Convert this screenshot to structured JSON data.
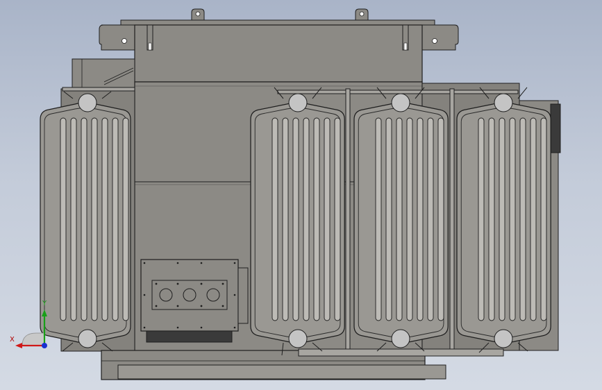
{
  "viewport": {
    "background_top": "#a9b4c8",
    "background_bottom": "#d4dae4"
  },
  "model": {
    "body_color": "#8c8a85",
    "edge_color": "#1e1e1e",
    "radiator_color": "#9a9893",
    "fin_color": "#bdbbb6",
    "plug_color": "#c4c4c4",
    "radiator_count": 4
  },
  "triad": {
    "x_label": "X",
    "y_label": "Y",
    "x_color": "#d01818",
    "y_color": "#18a018",
    "z_color": "#1830d0"
  }
}
